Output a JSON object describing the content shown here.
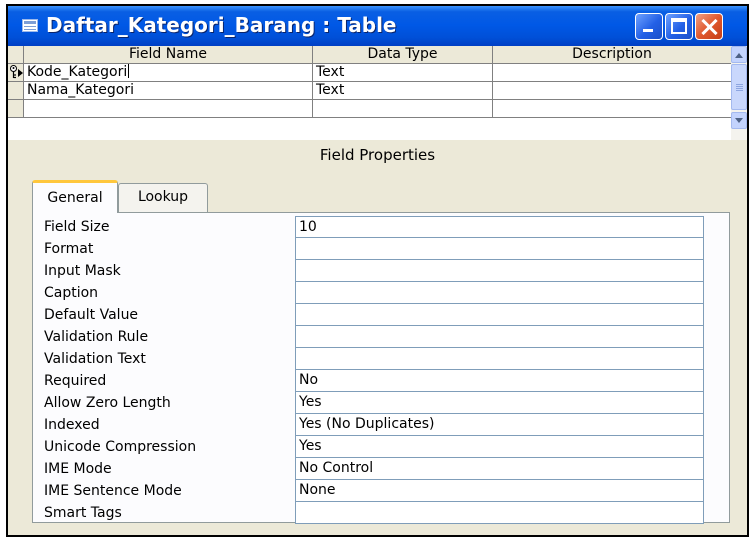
{
  "window": {
    "title": "Daftar_Kategori_Barang : Table",
    "icon": "table-icon"
  },
  "grid": {
    "headers": {
      "field_name": "Field Name",
      "data_type": "Data Type",
      "description": "Description"
    },
    "rows": [
      {
        "field_name": "Kode_Kategori",
        "data_type": "Text",
        "description": "",
        "primary_key": true,
        "current": true
      },
      {
        "field_name": "Nama_Kategori",
        "data_type": "Text",
        "description": ""
      },
      {
        "field_name": "",
        "data_type": "",
        "description": ""
      }
    ]
  },
  "field_properties": {
    "title": "Field Properties",
    "tabs": [
      "General",
      "Lookup"
    ],
    "active_tab": "General",
    "properties": [
      {
        "label": "Field Size",
        "value": "10"
      },
      {
        "label": "Format",
        "value": ""
      },
      {
        "label": "Input Mask",
        "value": ""
      },
      {
        "label": "Caption",
        "value": ""
      },
      {
        "label": "Default Value",
        "value": ""
      },
      {
        "label": "Validation Rule",
        "value": ""
      },
      {
        "label": "Validation Text",
        "value": ""
      },
      {
        "label": "Required",
        "value": "No"
      },
      {
        "label": "Allow Zero Length",
        "value": "Yes"
      },
      {
        "label": "Indexed",
        "value": "Yes (No Duplicates)"
      },
      {
        "label": "Unicode Compression",
        "value": "Yes"
      },
      {
        "label": "IME Mode",
        "value": "No Control"
      },
      {
        "label": "IME Sentence Mode",
        "value": "None"
      },
      {
        "label": "Smart Tags",
        "value": ""
      }
    ]
  },
  "colors": {
    "titlebar": "#0058e6",
    "close_button": "#e0592e",
    "active_tab_accent": "#ffc73c",
    "dialog_face": "#ece9d8"
  }
}
